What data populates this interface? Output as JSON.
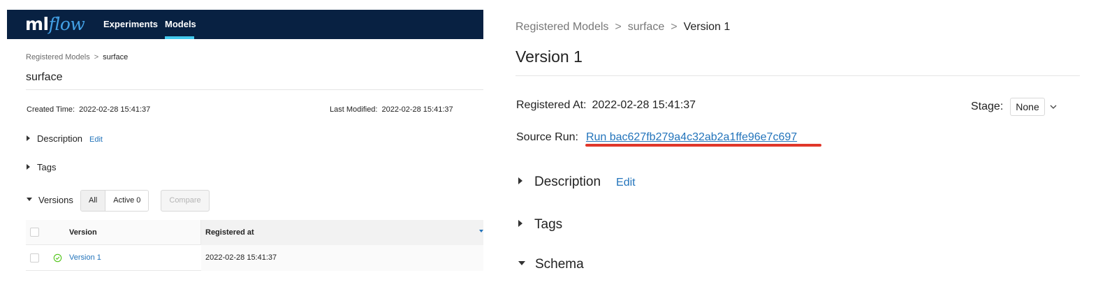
{
  "left": {
    "logo": {
      "ml": "ml",
      "flow": "flow"
    },
    "nav": {
      "experiments": "Experiments",
      "models": "Models"
    },
    "breadcrumb": {
      "root": "Registered Models",
      "separator": ">",
      "current": "surface"
    },
    "title": "surface",
    "meta": {
      "created_label": "Created Time:",
      "created_value": "2022-02-28 15:41:37",
      "modified_label": "Last Modified:",
      "modified_value": "2022-02-28 15:41:37"
    },
    "sections": {
      "description": "Description",
      "edit": "Edit",
      "tags": "Tags",
      "versions": "Versions"
    },
    "filters": {
      "all": "All",
      "active": "Active 0"
    },
    "compare": "Compare",
    "table": {
      "headers": {
        "version": "Version",
        "registered_at": "Registered at"
      },
      "rows": [
        {
          "version": "Version 1",
          "registered_at": "2022-02-28 15:41:37",
          "status": "ready"
        }
      ]
    }
  },
  "right": {
    "breadcrumb": {
      "root": "Registered Models",
      "sep1": ">",
      "model": "surface",
      "sep2": ">",
      "current": "Version 1"
    },
    "title": "Version 1",
    "registered_label": "Registered At:",
    "registered_value": "2022-02-28 15:41:37",
    "source_label": "Source Run:",
    "source_value": "Run bac627fb279a4c32ab2a1ffe96e7c697",
    "stage_label": "Stage:",
    "stage_value": "None",
    "sections": {
      "description": "Description",
      "edit": "Edit",
      "tags": "Tags",
      "schema": "Schema"
    }
  },
  "colors": {
    "navbar": "#082142",
    "accent": "#43c9ed",
    "link": "#2374bb",
    "highlight": "#e0372a",
    "success": "#52c41a"
  }
}
